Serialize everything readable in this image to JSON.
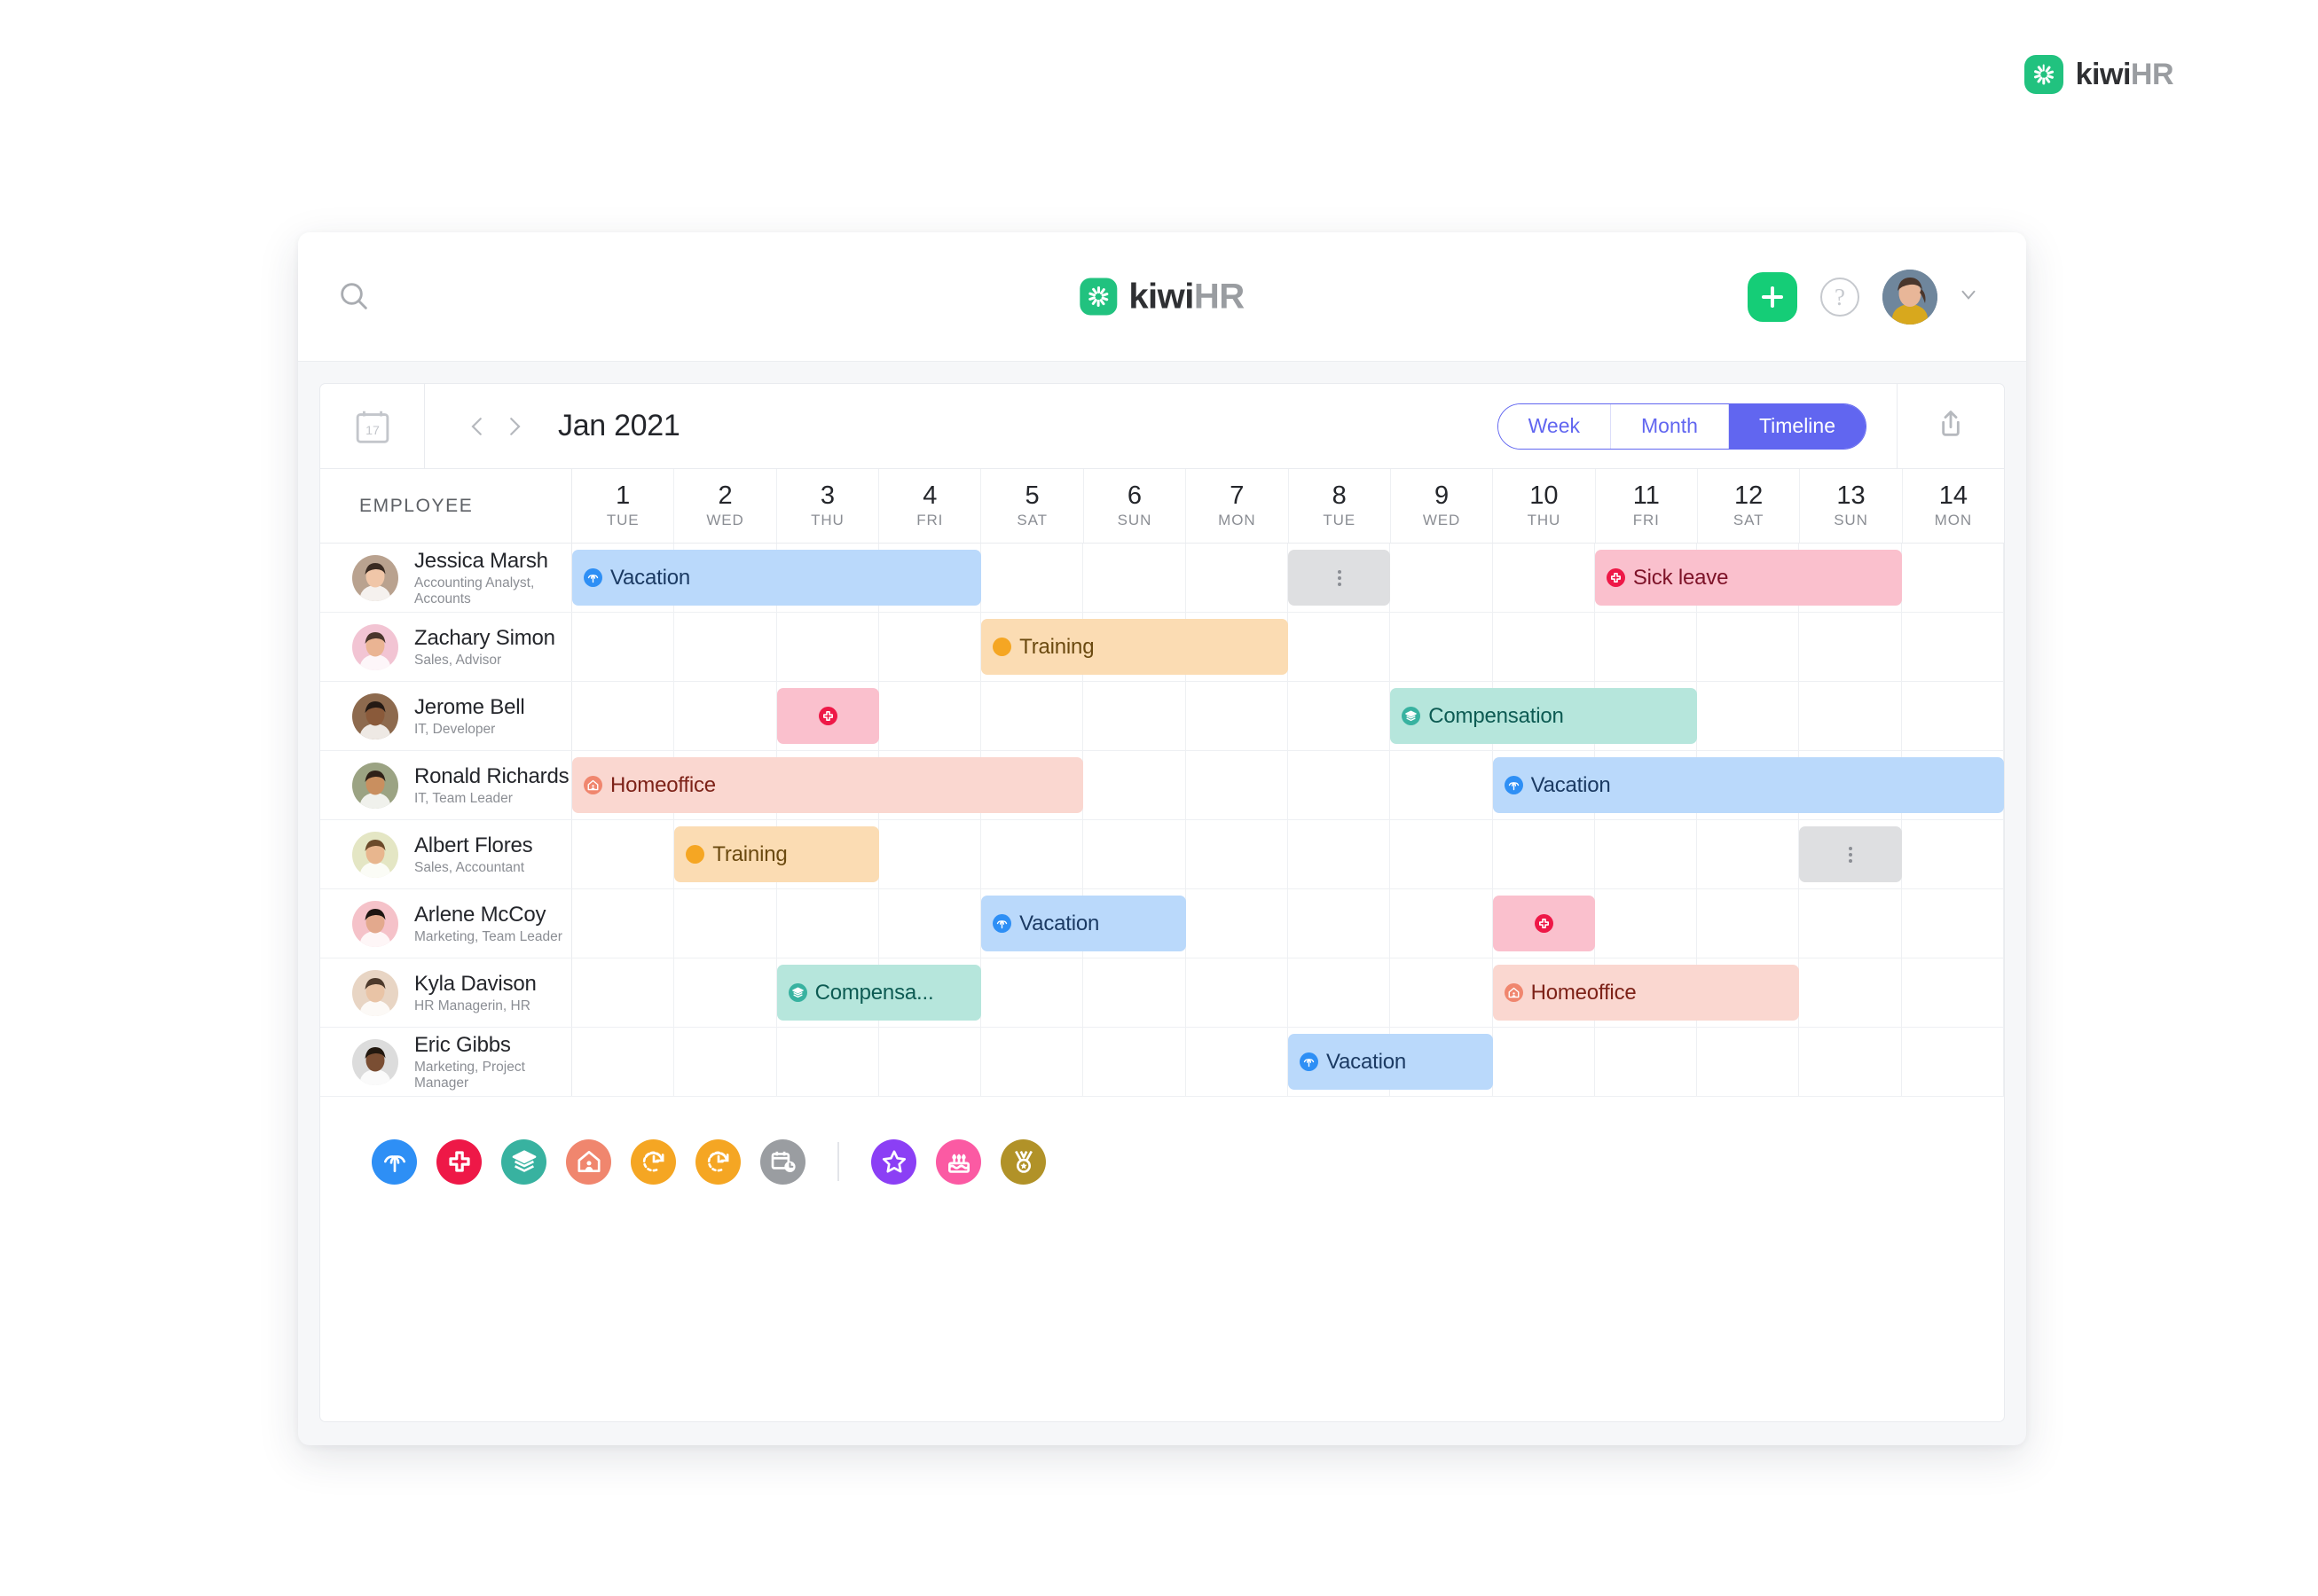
{
  "brand": {
    "kiwi": "kiwi",
    "hr": "HR"
  },
  "header": {
    "search_icon": "search-icon",
    "add_button_label": "+",
    "help_button_label": "?",
    "avatar_name": "user-avatar",
    "chevron_icon": "chevron-down-icon"
  },
  "toolbar": {
    "calendar_icon_day": "17",
    "prev_label": "‹",
    "next_label": "›",
    "month": "Jan 2021",
    "views": [
      {
        "label": "Week",
        "active": false
      },
      {
        "label": "Month",
        "active": false
      },
      {
        "label": "Timeline",
        "active": true
      }
    ],
    "export_icon": "export-icon",
    "accent_color": "#6166f0"
  },
  "grid": {
    "employee_column_header": "EMPLOYEE",
    "days": [
      {
        "num": "1",
        "dow": "TUE"
      },
      {
        "num": "2",
        "dow": "WED"
      },
      {
        "num": "3",
        "dow": "THU"
      },
      {
        "num": "4",
        "dow": "FRI"
      },
      {
        "num": "5",
        "dow": "SAT"
      },
      {
        "num": "6",
        "dow": "SUN"
      },
      {
        "num": "7",
        "dow": "MON"
      },
      {
        "num": "8",
        "dow": "TUE"
      },
      {
        "num": "9",
        "dow": "WED"
      },
      {
        "num": "10",
        "dow": "THU"
      },
      {
        "num": "11",
        "dow": "FRI"
      },
      {
        "num": "12",
        "dow": "SAT"
      },
      {
        "num": "13",
        "dow": "SUN"
      },
      {
        "num": "14",
        "dow": "MON"
      }
    ]
  },
  "employees": [
    {
      "name": "Jessica Marsh",
      "role": "Accounting Analyst, Accounts",
      "avatar_color": "#b9a28f",
      "events": [
        {
          "label": "Vacation",
          "type": "vacation",
          "start": 1,
          "span": 4,
          "bg": "#bad9fb",
          "fg": "#1b3a63",
          "icon_bg": "#2e8ff5"
        },
        {
          "label": "",
          "type": "placeholder",
          "start": 8,
          "span": 1,
          "bg": "#dedfe1",
          "fg": "#8b8e94",
          "icon_bg": ""
        },
        {
          "label": "Sick leave",
          "type": "sick",
          "start": 11,
          "span": 3,
          "bg": "#fac0cd",
          "fg": "#7d1228",
          "icon_bg": "#ee1847"
        }
      ]
    },
    {
      "name": "Zachary Simon",
      "role": "Sales, Advisor",
      "avatar_color": "#f2c4d3",
      "events": [
        {
          "label": "Training",
          "type": "training",
          "start": 5,
          "span": 3,
          "bg": "#fbdcb3",
          "fg": "#6b4a10",
          "icon_bg": "#f5a623"
        }
      ]
    },
    {
      "name": "Jerome Bell",
      "role": "IT, Developer",
      "avatar_color": "#8d6a4e",
      "events": [
        {
          "label": "",
          "type": "sick",
          "start": 3,
          "span": 1,
          "bg": "#fac0cd",
          "fg": "#7d1228",
          "icon_bg": "#ee1847"
        },
        {
          "label": "Compensation",
          "type": "compensation",
          "start": 9,
          "span": 3,
          "bg": "#b6e6dc",
          "fg": "#0d5b53",
          "icon_bg": "#38b2a0"
        }
      ]
    },
    {
      "name": "Ronald Richards",
      "role": "IT, Team Leader",
      "avatar_color": "#9ba383",
      "events": [
        {
          "label": "Homeoffice",
          "type": "homeoffice",
          "start": 1,
          "span": 5,
          "bg": "#fad7d0",
          "fg": "#7d2218",
          "icon_bg": "#f0866e"
        },
        {
          "label": "Vacation",
          "type": "vacation",
          "start": 10,
          "span": 5,
          "bg": "#bad9fb",
          "fg": "#1b3a63",
          "icon_bg": "#2e8ff5"
        }
      ]
    },
    {
      "name": "Albert Flores",
      "role": "Sales, Accountant",
      "avatar_color": "#e4e6c4",
      "events": [
        {
          "label": "Training",
          "type": "training",
          "start": 2,
          "span": 2,
          "bg": "#fbdcb3",
          "fg": "#6b4a10",
          "icon_bg": "#f5a623"
        },
        {
          "label": "",
          "type": "placeholder",
          "start": 13,
          "span": 1,
          "bg": "#dedfe1",
          "fg": "#8b8e94",
          "icon_bg": ""
        }
      ]
    },
    {
      "name": "Arlene McCoy",
      "role": "Marketing, Team Leader",
      "avatar_color": "#f5c2c9",
      "events": [
        {
          "label": "Vacation",
          "type": "vacation",
          "start": 5,
          "span": 2,
          "bg": "#bad9fb",
          "fg": "#1b3a63",
          "icon_bg": "#2e8ff5"
        },
        {
          "label": "",
          "type": "sick",
          "start": 10,
          "span": 1,
          "bg": "#fac0cd",
          "fg": "#7d1228",
          "icon_bg": "#ee1847"
        }
      ]
    },
    {
      "name": "Kyla Davison",
      "role": "HR Managerin, HR",
      "avatar_color": "#e8d5c4",
      "events": [
        {
          "label": "Compensa...",
          "type": "compensation",
          "start": 3,
          "span": 2,
          "bg": "#b6e6dc",
          "fg": "#0d5b53",
          "icon_bg": "#38b2a0"
        },
        {
          "label": "Homeoffice",
          "type": "homeoffice",
          "start": 10,
          "span": 3,
          "bg": "#fad7d0",
          "fg": "#7d2218",
          "icon_bg": "#f0866e"
        }
      ]
    },
    {
      "name": "Eric Gibbs",
      "role": "Marketing, Project Manager",
      "avatar_color": "#dcdcdc",
      "events": [
        {
          "label": "Vacation",
          "type": "vacation",
          "start": 8,
          "span": 2,
          "bg": "#bad9fb",
          "fg": "#1b3a63",
          "icon_bg": "#2e8ff5"
        }
      ]
    }
  ],
  "legend": [
    {
      "icon": "palm-tree-icon",
      "color": "#2e8ff5"
    },
    {
      "icon": "medical-cross-icon",
      "color": "#ee1847"
    },
    {
      "icon": "layers-icon",
      "color": "#38b2a0"
    },
    {
      "icon": "house-icon",
      "color": "#f0866e"
    },
    {
      "icon": "clock-arrow-icon",
      "color": "#f5a623"
    },
    {
      "icon": "clock-arrow-icon",
      "color": "#f5a623"
    },
    {
      "icon": "calendar-clock-icon",
      "color": "#9a9da1"
    },
    {
      "divider": true
    },
    {
      "icon": "star-icon",
      "color": "#8b3ff5"
    },
    {
      "icon": "birthday-cake-icon",
      "color": "#fb5aa3"
    },
    {
      "icon": "medal-icon",
      "color": "#b19228"
    }
  ]
}
